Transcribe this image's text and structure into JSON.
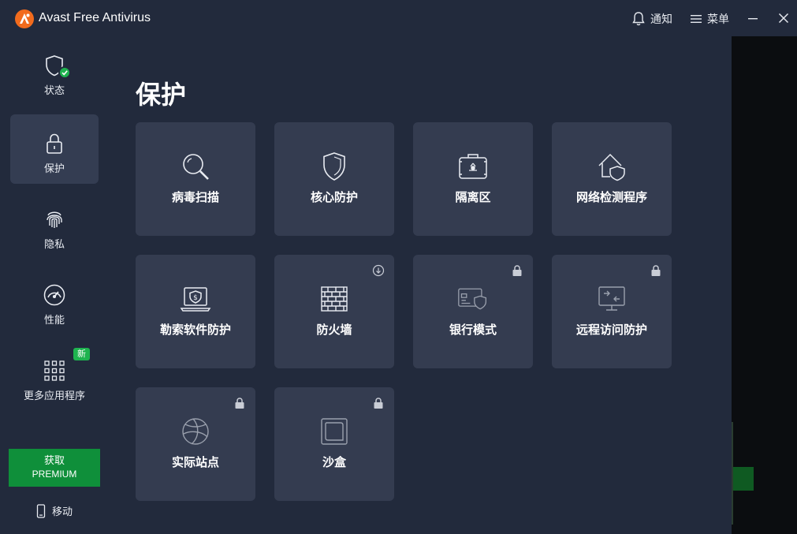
{
  "app": {
    "title": "Avast Free Antivirus"
  },
  "titlebar": {
    "notify_label": "通知",
    "menu_label": "菜单"
  },
  "sidebar": {
    "items": [
      {
        "label": "状态",
        "icon": "shield-check-icon"
      },
      {
        "label": "保护",
        "icon": "lock-icon"
      },
      {
        "label": "隐私",
        "icon": "fingerprint-icon"
      },
      {
        "label": "性能",
        "icon": "speedometer-icon"
      },
      {
        "label": "更多应用程序",
        "icon": "apps-grid-icon"
      }
    ],
    "new_badge": "新",
    "premium_line1": "获取",
    "premium_line2": "PREMIUM",
    "mobile_label": "移动"
  },
  "main": {
    "title": "保护",
    "cards": [
      {
        "label": "病毒扫描",
        "icon": "magnifier-icon"
      },
      {
        "label": "核心防护",
        "icon": "shield-icon"
      },
      {
        "label": "隔离区",
        "icon": "quarantine-box-icon"
      },
      {
        "label": "网络检测程序",
        "icon": "home-shield-icon"
      },
      {
        "label": "勒索软件防护",
        "icon": "ransomware-laptop-icon"
      },
      {
        "label": "防火墙",
        "icon": "brick-wall-icon",
        "corner": "download-icon"
      },
      {
        "label": "银行模式",
        "icon": "bank-card-shield-icon",
        "corner": "lock-icon"
      },
      {
        "label": "远程访问防护",
        "icon": "remote-monitor-icon",
        "corner": "lock-icon"
      },
      {
        "label": "实际站点",
        "icon": "globe-icon",
        "corner": "lock-icon"
      },
      {
        "label": "沙盒",
        "icon": "sandbox-icon",
        "corner": "lock-icon"
      }
    ]
  },
  "colors": {
    "background": "#222a3c",
    "card": "#343c50",
    "sidebar_active": "#343d52",
    "accent_green": "#1eb34f",
    "premium_green": "#0f8f3a",
    "brand_orange": "#f26b1d"
  }
}
